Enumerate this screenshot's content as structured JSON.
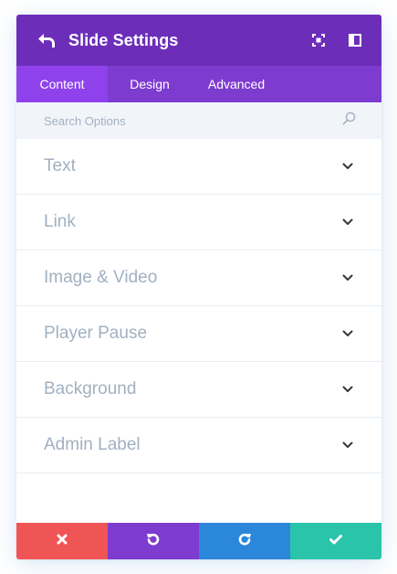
{
  "header": {
    "title": "Slide Settings",
    "back_icon": "undo-arrow-icon",
    "expand_icon": "fullscreen-icon",
    "sidebar_icon": "sidebar-toggle-icon",
    "background": "#6c2eb9"
  },
  "tabs": [
    {
      "label": "Content",
      "active": true
    },
    {
      "label": "Design",
      "active": false
    },
    {
      "label": "Advanced",
      "active": false
    }
  ],
  "search": {
    "placeholder": "Search Options",
    "icon": "search-icon"
  },
  "options": [
    {
      "label": "Text"
    },
    {
      "label": "Link"
    },
    {
      "label": "Image & Video"
    },
    {
      "label": "Player Pause"
    },
    {
      "label": "Background"
    },
    {
      "label": "Admin Label"
    }
  ],
  "footer": {
    "buttons": [
      {
        "icon": "close-icon",
        "color": "#ef5555"
      },
      {
        "icon": "undo-icon",
        "color": "#7e3bd0"
      },
      {
        "icon": "redo-icon",
        "color": "#2b87da"
      },
      {
        "icon": "check-icon",
        "color": "#29c4a9"
      }
    ]
  }
}
